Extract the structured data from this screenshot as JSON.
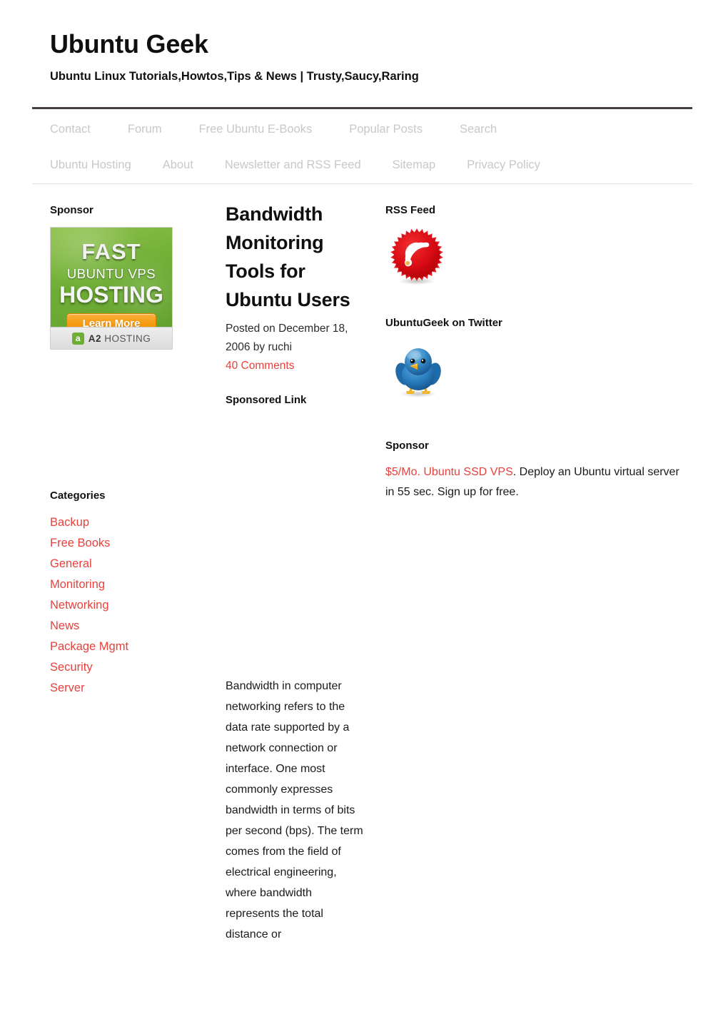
{
  "site": {
    "title": "Ubuntu Geek",
    "tagline": "Ubuntu Linux Tutorials,Howtos,Tips & News | Trusty,Saucy,Raring"
  },
  "nav": {
    "row1": [
      {
        "label": "Contact"
      },
      {
        "label": "Forum"
      },
      {
        "label": "Free Ubuntu E-Books"
      },
      {
        "label": "Popular Posts"
      },
      {
        "label": "Search"
      }
    ],
    "row2": [
      {
        "label": "Ubuntu Hosting"
      },
      {
        "label": "About"
      },
      {
        "label": "Newsletter and RSS Feed"
      },
      {
        "label": "Sitemap"
      },
      {
        "label": "Privacy Policy"
      }
    ]
  },
  "sidebar_left": {
    "sponsor_title": "Sponsor",
    "ad": {
      "line1": "FAST",
      "line2": "UBUNTU VPS",
      "line3": "HOSTING",
      "cta": "Learn More",
      "brand_mark": "a",
      "brand_bold": "A2",
      "brand_rest": "HOSTING"
    },
    "categories_title": "Categories",
    "categories": [
      {
        "label": "Backup"
      },
      {
        "label": "Free Books"
      },
      {
        "label": "General"
      },
      {
        "label": "Monitoring"
      },
      {
        "label": "Networking"
      },
      {
        "label": "News"
      },
      {
        "label": "Package Mgmt"
      },
      {
        "label": "Security"
      },
      {
        "label": "Server"
      }
    ]
  },
  "article": {
    "title": "Bandwidth Monitoring Tools for Ubuntu Users",
    "meta": "Posted on December 18, 2006 by ruchi",
    "comments": "40 Comments",
    "sponsored_link_title": "Sponsored Link",
    "body": "Bandwidth in computer networking refers to the data rate supported by a network connection or interface. One most commonly expresses bandwidth in terms of bits per second (bps). The term comes from the field of electrical engineering, where bandwidth represents the total distance or"
  },
  "sidebar_right": {
    "rss_title": "RSS Feed",
    "rss_icon": "rss-feed-icon",
    "twitter_title": "UbuntuGeek on Twitter",
    "twitter_icon": "twitter-bird-icon",
    "sponsor_title": "Sponsor",
    "sponsor_link": "$5/Mo. Ubuntu SSD VPS",
    "sponsor_text": ". Deploy an Ubuntu virtual server in 55 sec. Sign up for free."
  },
  "colors": {
    "link_red": "#e8413c",
    "nav_gray": "#c8c8c8",
    "rule_dark": "#45403d",
    "rule_light": "#dfdfdf",
    "ad_green": "#6fae36",
    "cta_orange": "#f59b10",
    "twitter_blue": "#2b7fc0"
  }
}
